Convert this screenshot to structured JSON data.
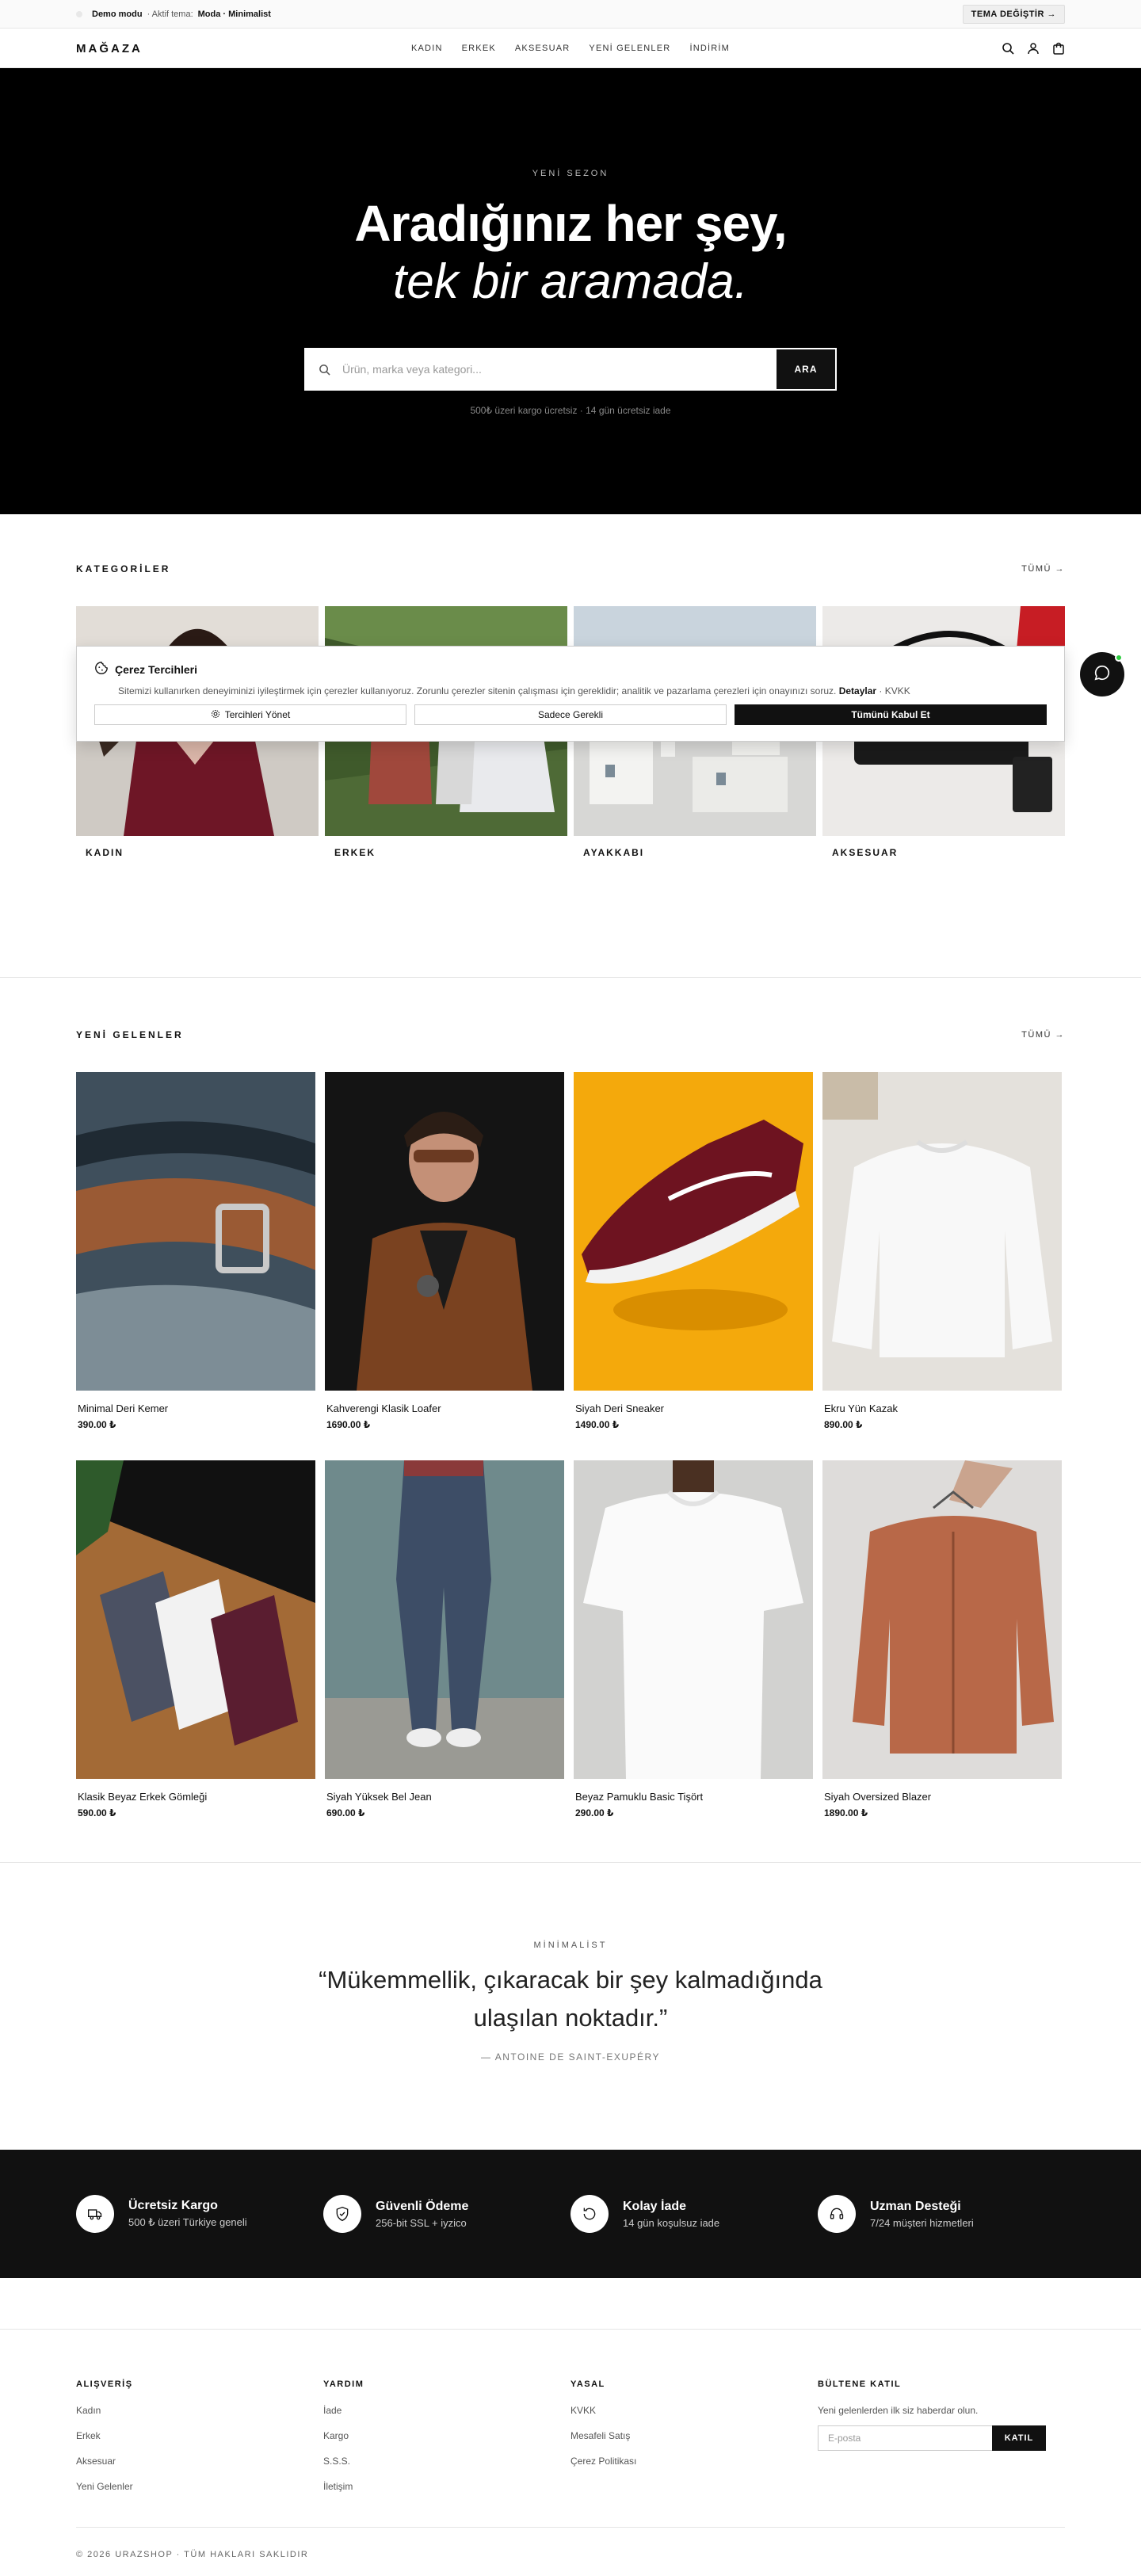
{
  "demo_bar": {
    "mode_label": "Demo modu",
    "theme_prefix": "· Aktif tema:",
    "theme_name": "Moda · Minimalist",
    "switch_label": "TEMA DEĞİŞTİR →"
  },
  "header": {
    "logo": "MAĞAZA",
    "nav": [
      "KADIN",
      "ERKEK",
      "AKSESUAR",
      "YENİ GELENLER",
      "İNDİRİM"
    ],
    "icons": [
      "search-icon",
      "user-icon",
      "bag-icon"
    ]
  },
  "hero": {
    "eyebrow": "YENİ SEZON",
    "title_line1": "Aradığınız her şey,",
    "title_line2": "tek bir aramada.",
    "search_placeholder": "Ürün, marka veya kategori...",
    "search_button": "ARA",
    "note": "500₺ üzeri kargo ücretsiz · 14 gün ücretsiz iade"
  },
  "categories": {
    "title": "KATEGORİLER",
    "all_link": "TÜMÜ →",
    "items": [
      {
        "label": "KADIN"
      },
      {
        "label": "ERKEK"
      },
      {
        "label": "AYAKKABI"
      },
      {
        "label": "AKSESUAR"
      }
    ]
  },
  "cookie": {
    "title": "Çerez Tercihleri",
    "text": "Sitemizi kullanırken deneyiminizi iyileştirmek için çerezler kullanıyoruz. Zorunlu çerezler sitenin çalışması için gereklidir; analitik ve pazarlama çerezleri için onayınızı soruz.",
    "details_link": "Detaylar",
    "kvkk_link": "KVKK",
    "manage_button": "Tercihleri Yönet",
    "necessary_button": "Sadece Gerekli",
    "accept_button": "Tümünü Kabul Et"
  },
  "new_arrivals": {
    "title": "YENİ GELENLER",
    "all_link": "TÜMÜ →",
    "products": [
      {
        "name": "Minimal Deri Kemer",
        "price": "390.00 ₺"
      },
      {
        "name": "Kahverengi Klasik Loafer",
        "price": "1690.00 ₺"
      },
      {
        "name": "Siyah Deri Sneaker",
        "price": "1490.00 ₺"
      },
      {
        "name": "Ekru Yün Kazak",
        "price": "890.00 ₺"
      },
      {
        "name": "Klasik Beyaz Erkek Gömleği",
        "price": "590.00 ₺"
      },
      {
        "name": "Siyah Yüksek Bel Jean",
        "price": "690.00 ₺"
      },
      {
        "name": "Beyaz Pamuklu Basic Tişört",
        "price": "290.00 ₺"
      },
      {
        "name": "Siyah Oversized Blazer",
        "price": "1890.00 ₺"
      }
    ]
  },
  "quote": {
    "eyebrow": "MİNİMALİST",
    "text": "“Mükemmellik, çıkaracak bir şey kalmadığında ulaşılan noktadır.”",
    "author": "— ANTOINE DE SAINT-EXUPÉRY"
  },
  "features": [
    {
      "icon": "truck-icon",
      "title": "Ücretsiz Kargo",
      "subtitle": "500 ₺ üzeri Türkiye geneli"
    },
    {
      "icon": "shield-icon",
      "title": "Güvenli Ödeme",
      "subtitle": "256-bit SSL + iyzico"
    },
    {
      "icon": "return-icon",
      "title": "Kolay İade",
      "subtitle": "14 gün koşulsuz iade"
    },
    {
      "icon": "headset-icon",
      "title": "Uzman Desteği",
      "subtitle": "7/24 müşteri hizmetleri"
    }
  ],
  "footer": {
    "columns": [
      {
        "title": "ALIŞVERİŞ",
        "links": [
          "Kadın",
          "Erkek",
          "Aksesuar",
          "Yeni Gelenler"
        ]
      },
      {
        "title": "YARDIM",
        "links": [
          "İade",
          "Kargo",
          "S.S.S.",
          "İletişim"
        ]
      },
      {
        "title": "YASAL",
        "links": [
          "KVKK",
          "Mesafeli Satış",
          "Çerez Politikası"
        ]
      }
    ],
    "newsletter": {
      "title": "BÜLTENE KATIL",
      "subtitle": "Yeni gelenlerden ilk siz haberdar olun.",
      "placeholder": "E-posta",
      "button": "KATIL"
    },
    "copyright": "© 2026 URAZSHOP · TÜM HAKLARI SAKLIDIR"
  }
}
